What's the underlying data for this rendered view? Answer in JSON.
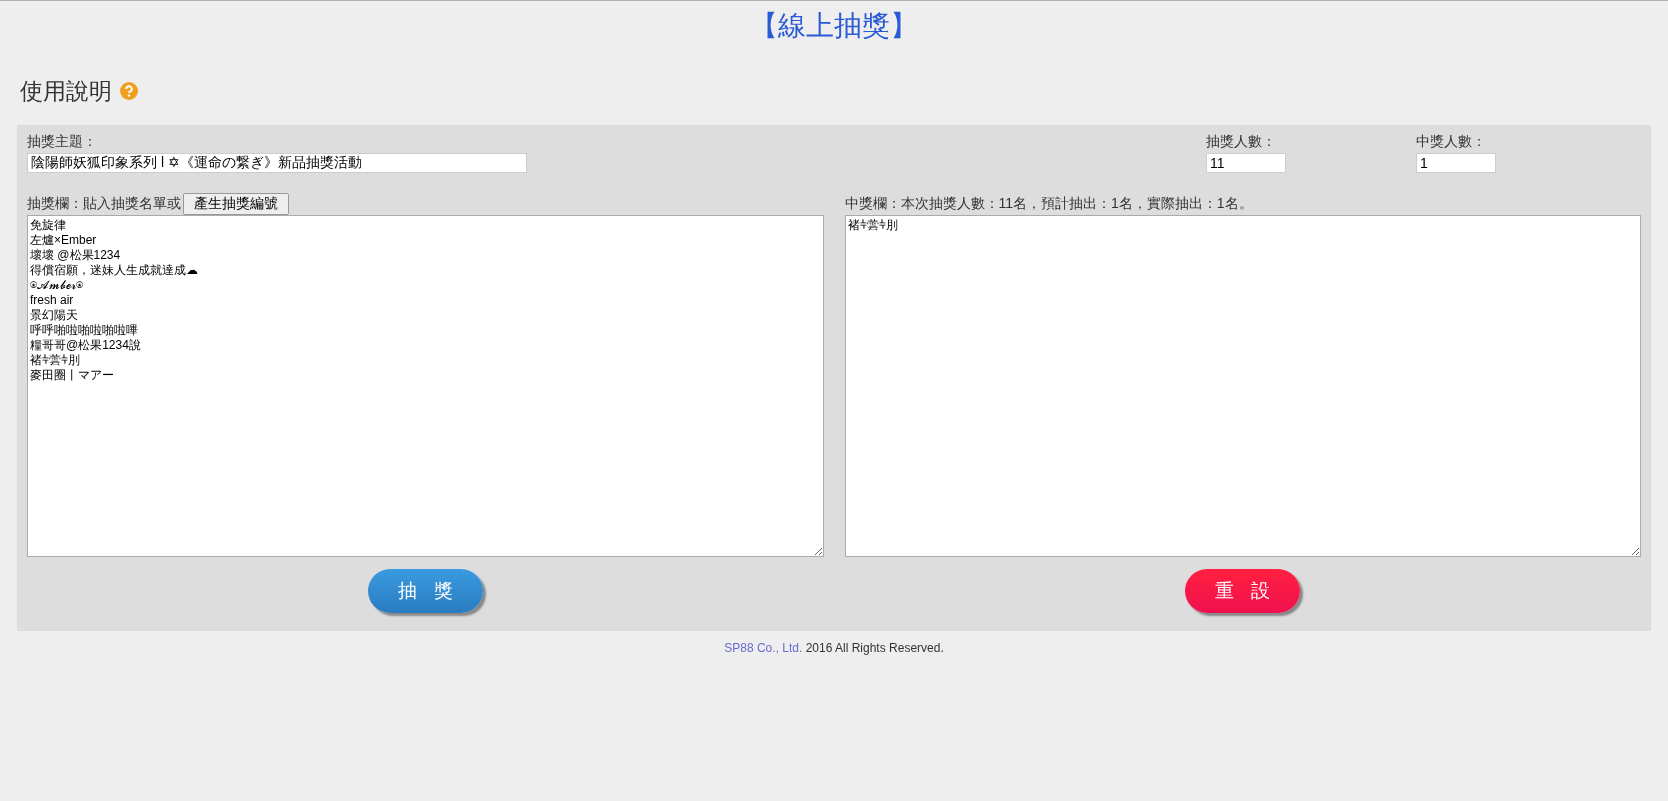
{
  "title": "【線上抽獎】",
  "help": {
    "heading": "使用說明"
  },
  "form": {
    "topic": {
      "label": "抽獎主題：",
      "value": "陰陽師妖狐印象系列 l ✡《運命の繋ぎ》新品抽獎活動"
    },
    "entrant_count": {
      "label": "抽獎人數：",
      "value": "11"
    },
    "winner_count": {
      "label": "中獎人數：",
      "value": "1"
    }
  },
  "entries": {
    "label": "抽獎欄：貼入抽獎名單或",
    "generate_button": "產生抽獎編號",
    "lines": [
      "免旋律",
      "左爐×Ember",
      "壞壞 @松果1234",
      "得償宿願，迷妹人生成就達成☁",
      "⍟𝓐𝓶𝓫𝓮𝓻⍟",
      "fresh air",
      "景幻陽天",
      "呼呼啪啦啪啦啪啦嗶",
      "糧哥哥@松果1234說",
      "褚⫩蕓⫩刖",
      "麥田圈丨マアー"
    ]
  },
  "winners": {
    "label": "中獎欄：本次抽獎人數：11名，預計抽出：1名，實際抽出：1名。",
    "lines": [
      "褚⫩蕓⫩刖"
    ]
  },
  "buttons": [
    {
      "label": "抽獎",
      "kind": "draw"
    },
    {
      "label": "重設",
      "kind": "reset"
    }
  ],
  "footer": {
    "company": "SP88 Co., Ltd.",
    "text": "2016 All Rights Reserved."
  }
}
